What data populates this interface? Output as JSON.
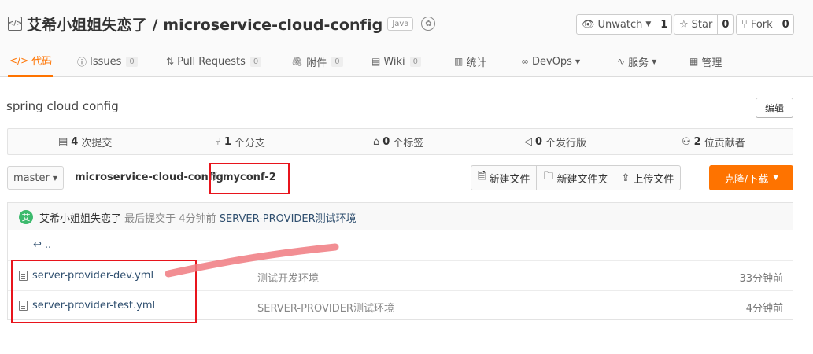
{
  "repo": {
    "owner_and_name": "艾希小姐姐失恋了 / microservice-cloud-config",
    "language": "Java",
    "actions": [
      {
        "label": "Unwatch",
        "count": "1",
        "icon": "eye-icon"
      },
      {
        "label": "Star",
        "count": "0",
        "icon": "star-icon"
      },
      {
        "label": "Fork",
        "count": "0",
        "icon": "fork-icon"
      }
    ]
  },
  "tabs": [
    {
      "label": "代码",
      "icon": "code-icon",
      "active": true
    },
    {
      "label": "Issues",
      "count": "0",
      "icon": "issue-icon"
    },
    {
      "label": "Pull Requests",
      "count": "0",
      "icon": "pull-request-icon"
    },
    {
      "label": "附件",
      "count": "0",
      "icon": "paperclip-icon"
    },
    {
      "label": "Wiki",
      "count": "0",
      "icon": "wiki-icon"
    },
    {
      "label": "统计",
      "icon": "bar-chart-icon"
    },
    {
      "label": "DevOps",
      "icon": "devops-icon",
      "dropdown": true
    },
    {
      "label": "服务",
      "icon": "pulse-icon",
      "dropdown": true
    },
    {
      "label": "管理",
      "icon": "settings-doc-icon"
    }
  ],
  "description": "spring cloud config",
  "edit_label": "编辑",
  "stats": [
    {
      "num": "4",
      "label": "次提交",
      "icon": "commit-icon"
    },
    {
      "num": "1",
      "label": "个分支",
      "icon": "branch-icon"
    },
    {
      "num": "0",
      "label": "个标签",
      "icon": "tag-icon"
    },
    {
      "num": "0",
      "label": "个发行版",
      "icon": "release-icon"
    },
    {
      "num": "2",
      "label": "位贡献者",
      "icon": "contributors-icon"
    }
  ],
  "branch": "master",
  "breadcrumb": {
    "repo": "microservice-cloud-config",
    "sep": "/",
    "folder": "myconf-2"
  },
  "file_actions": [
    "新建文件",
    "新建文件夹",
    "上传文件"
  ],
  "clone_label": "克隆/下载",
  "last_commit": {
    "avatar_letter": "艾",
    "author": "艾希小姐姐失恋了",
    "meta": "最后提交于 4分钟前",
    "message": "SERVER-PROVIDER测试环境"
  },
  "parent_link": "..",
  "files": [
    {
      "name": "server-provider-dev.yml",
      "message": "测试开发环境",
      "time": "33分钟前"
    },
    {
      "name": "server-provider-test.yml",
      "message": "SERVER-PROVIDER测试环境",
      "time": "4分钟前"
    }
  ],
  "colors": {
    "accent": "#fe7300",
    "annotation_box": "#e8141c",
    "annotation_stroke": "#f07a80"
  }
}
